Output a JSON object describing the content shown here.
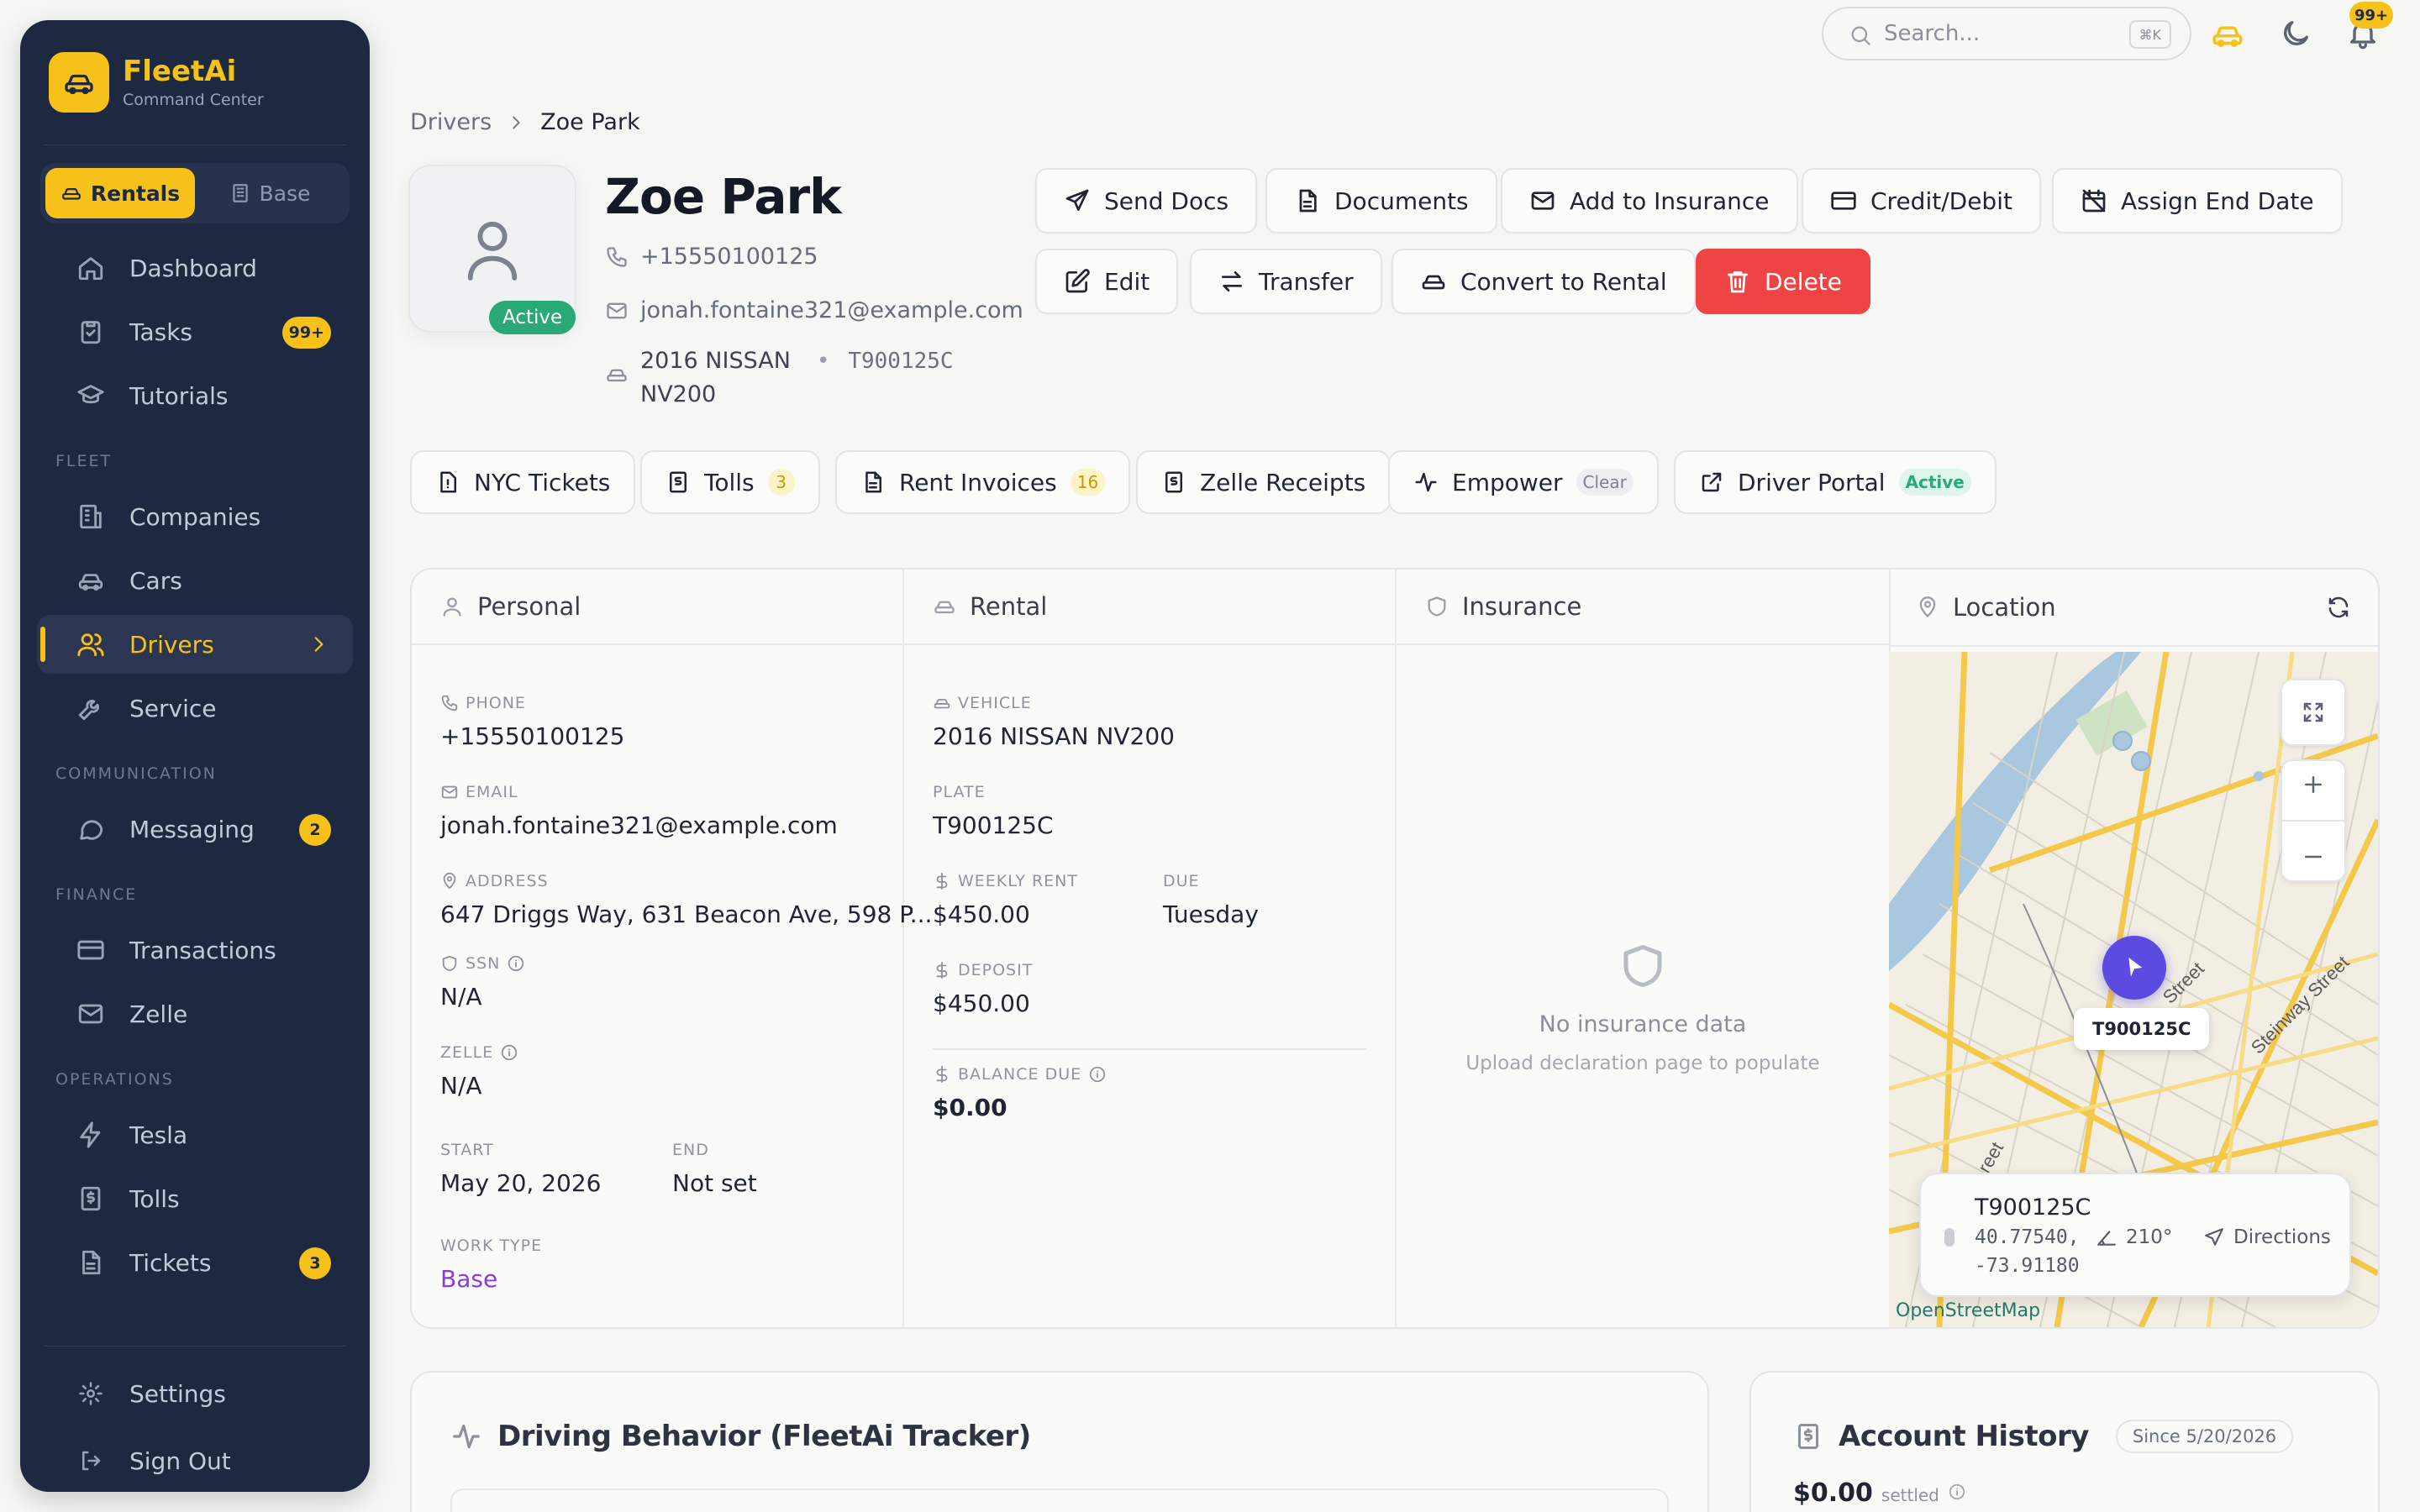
{
  "brand": {
    "name": "FleetAi",
    "subtitle": "Command Center"
  },
  "mode_switch": {
    "rentals": "Rentals",
    "base": "Base",
    "active": "rentals"
  },
  "nav": {
    "dashboard": "Dashboard",
    "tasks": "Tasks",
    "tasks_badge": "99+",
    "tutorials": "Tutorials",
    "section_fleet": "FLEET",
    "companies": "Companies",
    "cars": "Cars",
    "drivers": "Drivers",
    "service": "Service",
    "section_communication": "COMMUNICATION",
    "messaging": "Messaging",
    "messaging_badge": "2",
    "section_finance": "FINANCE",
    "transactions": "Transactions",
    "zelle": "Zelle",
    "section_operations": "OPERATIONS",
    "tesla": "Tesla",
    "tolls": "Tolls",
    "tickets": "Tickets",
    "tickets_badge": "3",
    "settings": "Settings",
    "sign_out": "Sign Out"
  },
  "topbar": {
    "search_placeholder": "Search...",
    "shortcut": "⌘K",
    "notif_badge": "99+"
  },
  "breadcrumb": {
    "parent": "Drivers",
    "current": "Zoe Park"
  },
  "driver": {
    "name": "Zoe Park",
    "status": "Active",
    "phone": "+15550100125",
    "email": "jonah.fontaine321@example.com",
    "vehicle": "2016 NISSAN NV200",
    "plate": "T900125C"
  },
  "actions": {
    "send_docs": "Send Docs",
    "documents": "Documents",
    "add_insurance": "Add to Insurance",
    "credit_debit": "Credit/Debit",
    "assign_end_date": "Assign End Date",
    "edit": "Edit",
    "transfer": "Transfer",
    "convert_rental": "Convert to Rental",
    "delete": "Delete"
  },
  "chips": {
    "nyc_tickets": "NYC Tickets",
    "tolls": "Tolls",
    "tolls_count": "3",
    "rent_invoices": "Rent Invoices",
    "rent_invoices_count": "16",
    "zelle_receipts": "Zelle Receipts",
    "empower": "Empower",
    "empower_status": "Clear",
    "driver_portal": "Driver Portal",
    "driver_portal_status": "Active"
  },
  "personal": {
    "title": "Personal",
    "phone_label": "PHONE",
    "phone": "+15550100125",
    "email_label": "EMAIL",
    "email": "jonah.fontaine321@example.com",
    "address_label": "ADDRESS",
    "address": "647 Driggs Way, 631 Beacon Ave, 598 P...",
    "ssn_label": "SSN",
    "ssn": "N/A",
    "zelle_label": "ZELLE",
    "zelle": "N/A",
    "start_label": "START",
    "start": "May 20, 2026",
    "end_label": "END",
    "end": "Not set",
    "work_type_label": "WORK TYPE",
    "work_type": "Base"
  },
  "rental": {
    "title": "Rental",
    "vehicle_label": "VEHICLE",
    "vehicle": "2016 NISSAN NV200",
    "plate_label": "PLATE",
    "plate": "T900125C",
    "weekly_rent_label": "WEEKLY RENT",
    "weekly_rent": "$450.00",
    "due_label": "DUE",
    "due": "Tuesday",
    "deposit_label": "DEPOSIT",
    "deposit": "$450.00",
    "balance_label": "BALANCE DUE",
    "balance": "$0.00"
  },
  "insurance": {
    "title": "Insurance",
    "empty_title": "No insurance data",
    "empty_sub": "Upload declaration page to populate"
  },
  "location": {
    "title": "Location",
    "marker_label": "T900125C",
    "plate": "T900125C",
    "lat": "40.77540,",
    "lng": "-73.91180",
    "heading": "210°",
    "directions": "Directions",
    "attribution": "OpenStreetMap",
    "street_1": "Street",
    "street_2": "Steinway Street",
    "street_3": "reet"
  },
  "driving_behavior": {
    "title": "Driving Behavior (FleetAi Tracker)"
  },
  "account_history": {
    "title": "Account History",
    "since": "Since 5/20/2026",
    "amount": "$0.00",
    "amount_note": "settled"
  },
  "colors": {
    "accent": "#f6c21a",
    "sidebar": "#1d2941",
    "danger": "#ef4444",
    "success": "#2aa876",
    "marker": "#5b4be0"
  }
}
